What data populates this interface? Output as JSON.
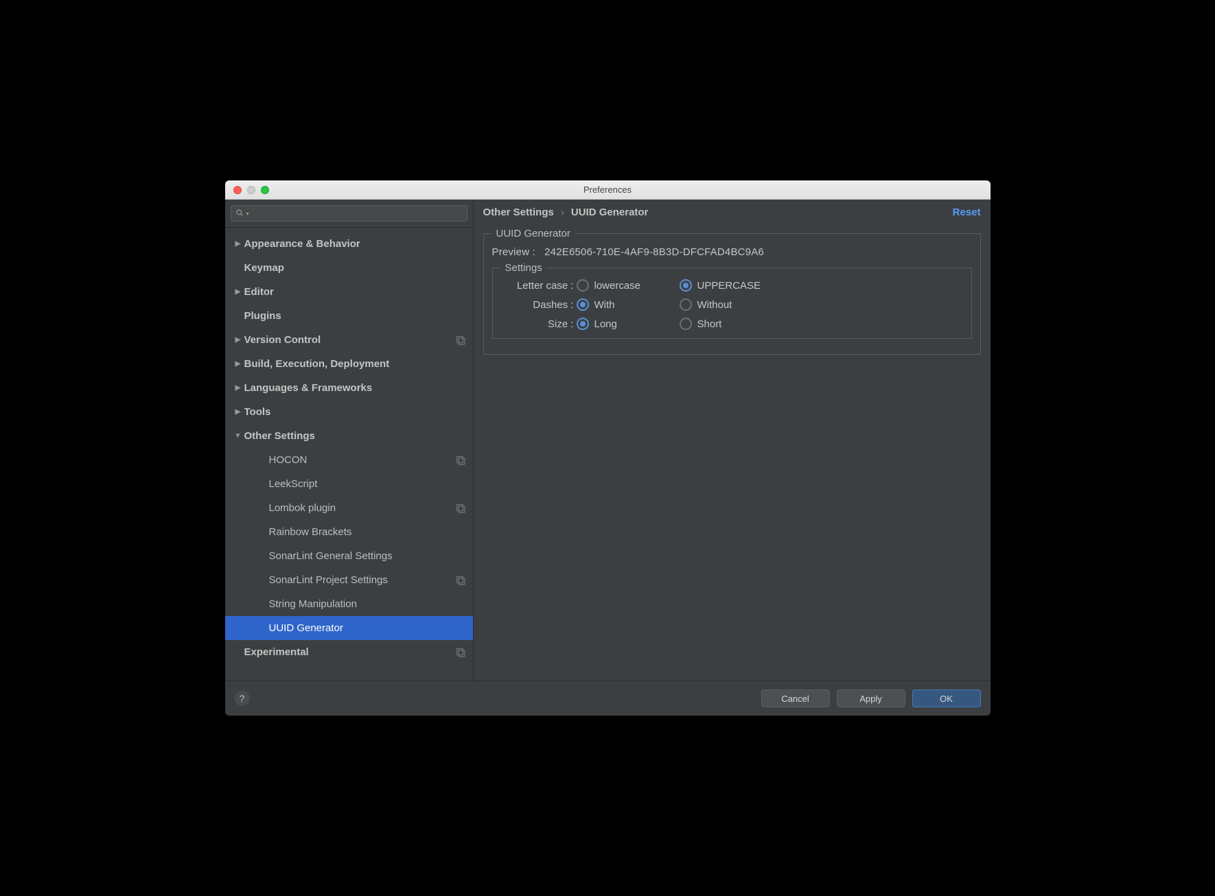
{
  "window": {
    "title": "Preferences"
  },
  "sidebar": {
    "search_placeholder": "",
    "items": [
      {
        "label": "Appearance & Behavior",
        "top": true,
        "arrow": "right"
      },
      {
        "label": "Keymap",
        "top": true,
        "arrow": "none"
      },
      {
        "label": "Editor",
        "top": true,
        "arrow": "right"
      },
      {
        "label": "Plugins",
        "top": true,
        "arrow": "none"
      },
      {
        "label": "Version Control",
        "top": true,
        "arrow": "right",
        "project": true
      },
      {
        "label": "Build, Execution, Deployment",
        "top": true,
        "arrow": "right"
      },
      {
        "label": "Languages & Frameworks",
        "top": true,
        "arrow": "right"
      },
      {
        "label": "Tools",
        "top": true,
        "arrow": "right"
      },
      {
        "label": "Other Settings",
        "top": true,
        "arrow": "down"
      },
      {
        "label": "HOCON",
        "top": false,
        "project": true
      },
      {
        "label": "LeekScript",
        "top": false
      },
      {
        "label": "Lombok plugin",
        "top": false,
        "project": true
      },
      {
        "label": "Rainbow Brackets",
        "top": false
      },
      {
        "label": "SonarLint General Settings",
        "top": false
      },
      {
        "label": "SonarLint Project Settings",
        "top": false,
        "project": true
      },
      {
        "label": "String Manipulation",
        "top": false
      },
      {
        "label": "UUID Generator",
        "top": false,
        "selected": true
      },
      {
        "label": "Experimental",
        "top": true,
        "arrow": "none",
        "project": true
      }
    ]
  },
  "breadcrumb": {
    "parent": "Other Settings",
    "current": "UUID Generator"
  },
  "reset_label": "Reset",
  "panel": {
    "group_title": "UUID Generator",
    "preview_label": "Preview :",
    "preview_value": "242E6506-710E-4AF9-8B3D-DFCFAD4BC9A6",
    "settings_title": "Settings",
    "rows": {
      "letter_case": {
        "label": "Letter case :",
        "opt_a": "lowercase",
        "opt_b": "UPPERCASE",
        "checked": "b"
      },
      "dashes": {
        "label": "Dashes :",
        "opt_a": "With",
        "opt_b": "Without",
        "checked": "a"
      },
      "size": {
        "label": "Size :",
        "opt_a": "Long",
        "opt_b": "Short",
        "checked": "a"
      }
    }
  },
  "footer": {
    "cancel": "Cancel",
    "apply": "Apply",
    "ok": "OK"
  }
}
